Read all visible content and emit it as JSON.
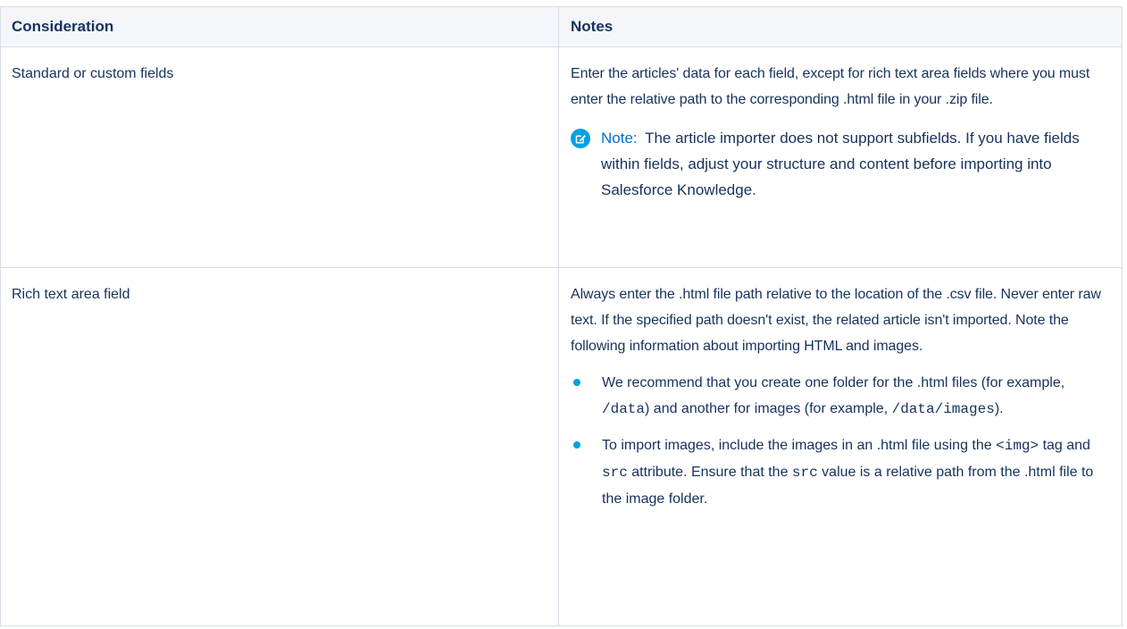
{
  "table": {
    "headers": {
      "consideration": "Consideration",
      "notes": "Notes"
    },
    "rows": [
      {
        "consideration": "Standard or custom fields",
        "notes": "Enter the articles' data for each field, except for rich text area fields where you must enter the relative path to the corresponding .html file in your .zip file.",
        "note": {
          "label": "Note:",
          "text": "The article importer does not support subfields. If you have fields within fields, adjust your structure and content before importing into Salesforce Knowledge.",
          "icon": "note-edit-icon"
        }
      },
      {
        "consideration": "Rich text area field",
        "notes": "Always enter the .html file path relative to the location of the .csv file. Never enter raw text. If the specified path doesn't exist, the related article isn't imported. Note the following information about importing HTML and images.",
        "bullets": [
          {
            "t1": "We recommend that you create one folder for the .html files (for example, ",
            "c1": "/data",
            "t2": ") and another for images (for example, ",
            "c2": "/data/images",
            "t3": ")."
          },
          {
            "t1": "To import images, include the images in an .html file using the ",
            "c1": "<img>",
            "t2": " tag and ",
            "c2": "src",
            "t3": " attribute. Ensure that the ",
            "c3": "src",
            "t4": " value is a relative path from the .html file to the image folder."
          }
        ]
      }
    ]
  },
  "colors": {
    "accent_note": "#0070d2",
    "bullet": "#00a1e0",
    "text": "#16325c",
    "header_bg": "#f4f6f9",
    "border": "#d8dde6"
  }
}
